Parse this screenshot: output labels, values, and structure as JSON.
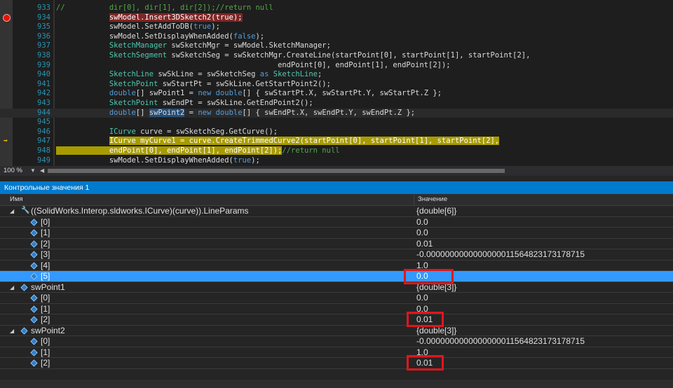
{
  "editor": {
    "lines": [
      {
        "n": "933",
        "cls": "",
        "html": "<span class=\"cm\">//          dir[0], dir[1], dir[2]);//return null</span>"
      },
      {
        "n": "934",
        "cls": "",
        "html": "            <span class=\"bphl\">swModel.Insert3DSketch2(<span class=\"kw\" style=\"color:#fff\">true</span>);</span>"
      },
      {
        "n": "935",
        "cls": "",
        "html": "            swModel.SetAddToDB(<span class=\"kw\">true</span>);"
      },
      {
        "n": "936",
        "cls": "",
        "html": "            swModel.SetDisplayWhenAdded(<span class=\"kw\">false</span>);"
      },
      {
        "n": "937",
        "cls": "",
        "html": "            <span class=\"ty\">SketchManager</span> swSketchMgr = swModel.SketchManager;"
      },
      {
        "n": "938",
        "cls": "",
        "html": "            <span class=\"ty\">SketchSegment</span> swSketchSeg = swSketchMgr.CreateLine(startPoint[0], startPoint[1], startPoint[2],"
      },
      {
        "n": "939",
        "cls": "",
        "html": "                                                  endPoint[0], endPoint[1], endPoint[2]);"
      },
      {
        "n": "940",
        "cls": "",
        "html": "            <span class=\"ty\">SketchLine</span> swSkLine = swSketchSeg <span class=\"kw\">as</span> <span class=\"ty\">SketchLine</span>;"
      },
      {
        "n": "941",
        "cls": "",
        "html": "            <span class=\"ty\">SketchPoint</span> swStartPt = swSkLine.GetStartPoint2();"
      },
      {
        "n": "942",
        "cls": "",
        "html": "            <span class=\"kw\">double</span>[] swPoint1 = <span class=\"kw\">new</span> <span class=\"kw\">double</span>[] { swStartPt.X, swStartPt.Y, swStartPt.Z };"
      },
      {
        "n": "943",
        "cls": "",
        "html": "            <span class=\"ty\">SketchPoint</span> swEndPt = swSkLine.GetEndPoint2();"
      },
      {
        "n": "944",
        "cls": "cur",
        "html": "            <span class=\"kw\">double</span>[] <span class=\"vhl\">swPoint2</span> = <span class=\"kw\">new</span> <span class=\"kw\">double</span>[] { swEndPt.X, swEndPt.Y, swEndPt.Z };"
      },
      {
        "n": "945",
        "cls": "",
        "html": ""
      },
      {
        "n": "946",
        "cls": "",
        "html": "            <span class=\"ty\">ICurve</span> curve = swSketchSeg.GetCurve();"
      },
      {
        "n": "947",
        "cls": "",
        "html": "            <span class=\"exhl\"><span class=\"ty\">ICurve</span> myCurve1 = curve.CreateTrimmedCurve2(startPoint[0], startPoint[1], startPoint[2],</span>"
      },
      {
        "n": "948",
        "cls": "",
        "html": "<span class=\"exhl\">            endPoint[0], endPoint[1], endPoint[2]);</span><span class=\"cm\">//return null</span>"
      },
      {
        "n": "949",
        "cls": "",
        "html": "            swModel.SetDisplayWhenAdded(<span class=\"kw\">true</span>);"
      }
    ]
  },
  "zoom": {
    "label": "100 %"
  },
  "watch": {
    "title": "Контрольные значения 1",
    "col_name": "Имя",
    "col_value": "Значение",
    "rows": [
      {
        "level": 0,
        "icon": "wrench",
        "expanded": true,
        "name": "((SolidWorks.Interop.sldworks.ICurve)(curve)).LineParams",
        "value": "{double[6]}",
        "selected": false
      },
      {
        "level": 1,
        "icon": "cube",
        "name": "[0]",
        "value": "0.0",
        "selected": false
      },
      {
        "level": 1,
        "icon": "cube",
        "name": "[1]",
        "value": "0.0",
        "selected": false
      },
      {
        "level": 1,
        "icon": "cube",
        "name": "[2]",
        "value": "0.01",
        "selected": false
      },
      {
        "level": 1,
        "icon": "cube",
        "name": "[3]",
        "value": "-0.0000000000000000011564823173178715",
        "selected": false
      },
      {
        "level": 1,
        "icon": "cube",
        "name": "[4]",
        "value": "1.0",
        "selected": false
      },
      {
        "level": 1,
        "icon": "cube",
        "name": "[5]",
        "value": "0.0",
        "selected": true
      },
      {
        "level": 0,
        "icon": "cube",
        "expanded": true,
        "name": "swPoint1",
        "value": "{double[3]}",
        "selected": false
      },
      {
        "level": 1,
        "icon": "cube",
        "name": "[0]",
        "value": "0.0",
        "selected": false
      },
      {
        "level": 1,
        "icon": "cube",
        "name": "[1]",
        "value": "0.0",
        "selected": false
      },
      {
        "level": 1,
        "icon": "cube",
        "name": "[2]",
        "value": "0.01",
        "selected": false
      },
      {
        "level": 0,
        "icon": "cube",
        "expanded": true,
        "name": "swPoint2",
        "value": "{double[3]}",
        "selected": false
      },
      {
        "level": 1,
        "icon": "cube",
        "name": "[0]",
        "value": "-0.0000000000000000011564823173178715",
        "selected": false
      },
      {
        "level": 1,
        "icon": "cube",
        "name": "[1]",
        "value": "1.0",
        "selected": false
      },
      {
        "level": 1,
        "icon": "cube",
        "name": "[2]",
        "value": "0.01",
        "selected": false
      }
    ]
  },
  "colors": {
    "accent": "#007acc",
    "selection": "#3399ff",
    "breakpoint": "#e51400",
    "highlight_box": "#e0161b"
  }
}
